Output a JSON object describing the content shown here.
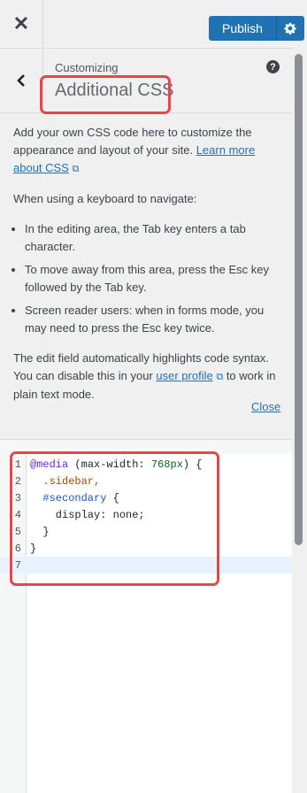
{
  "topbar": {
    "close_label": "✕",
    "publish_label": "Publish"
  },
  "panel": {
    "breadcrumb": "Customizing",
    "title": "Additional CSS",
    "help": "?"
  },
  "description": {
    "intro_before": "Add your own CSS code here to customize the appearance and layout of your site. ",
    "learn_more_link": "Learn more about CSS",
    "keyboard_heading": "When using a keyboard to navigate:",
    "bullets": [
      "In the editing area, the Tab key enters a tab character.",
      "To move away from this area, press the Esc key followed by the Tab key.",
      "Screen reader users: when in forms mode, you may need to press the Esc key twice."
    ],
    "highlight_before": "The edit field automatically highlights code syntax. You can disable this in your ",
    "user_profile_link": "user profile",
    "highlight_after": " to work in plain text mode.",
    "close_link": "Close"
  },
  "editor": {
    "line_numbers": [
      "1",
      "2",
      "3",
      "4",
      "5",
      "6",
      "7"
    ],
    "tokens": {
      "media": "@media",
      "cond_open": " (max-width: ",
      "num": "768px",
      "cond_close": ") {",
      "sidebar": "  .sidebar,",
      "secondary": "  #secondary",
      "brace_open": " {",
      "decl": "    display: none;",
      "brace_inner": "  }",
      "brace_outer": "}"
    }
  },
  "colors": {
    "accent": "#2271b1",
    "highlight_box": "#e2474b"
  }
}
